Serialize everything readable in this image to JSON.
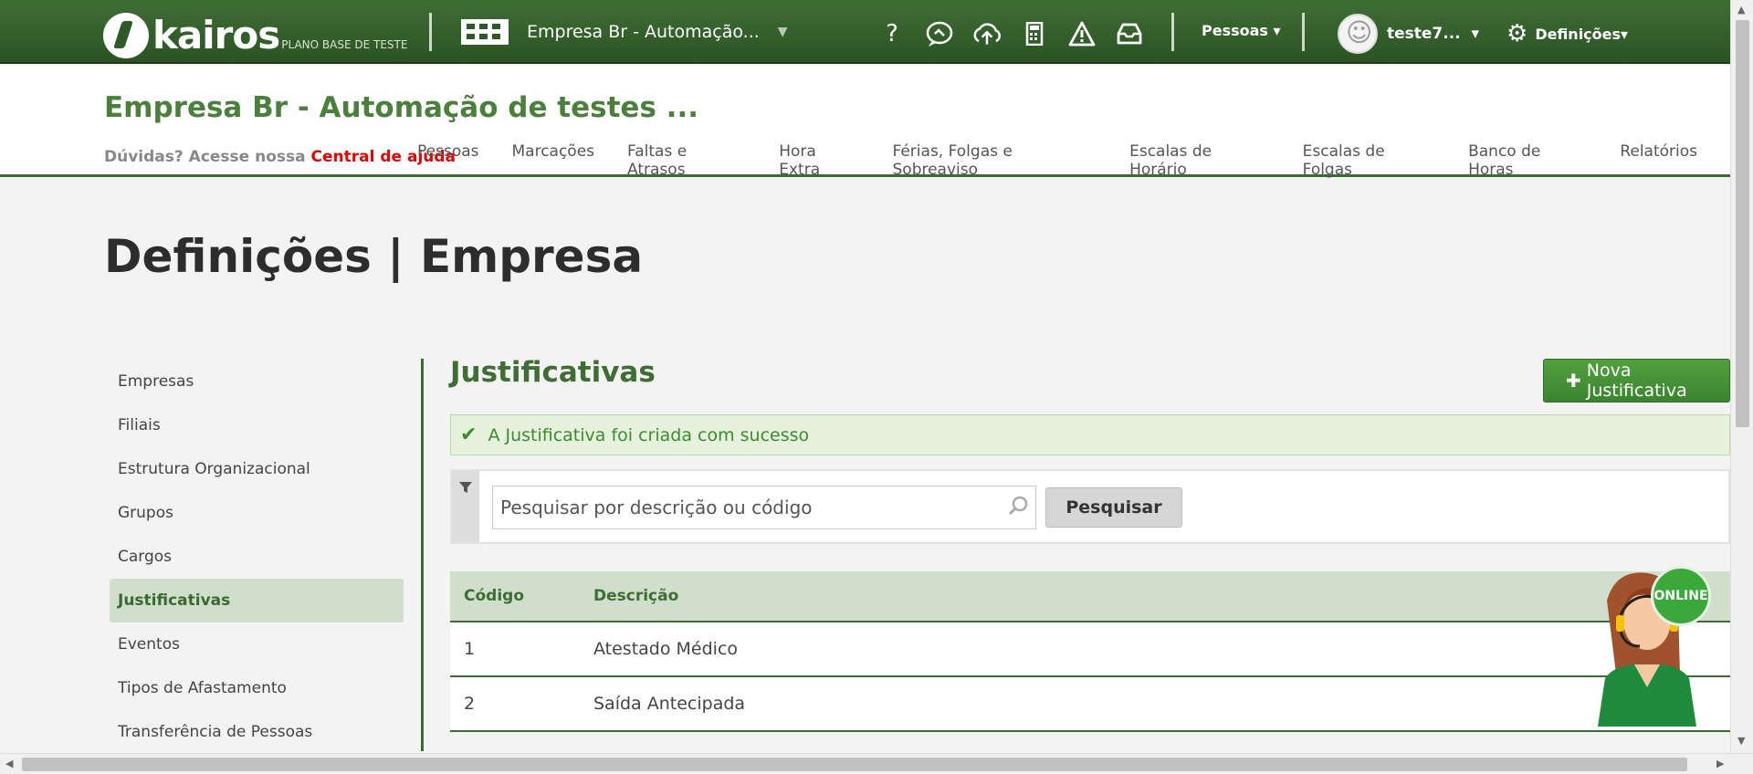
{
  "topbar": {
    "logo_text": "kairos",
    "logo_subtitle": "PLANO BASE DE TESTE",
    "company_selector": "Empresa Br - Automação...",
    "icons": [
      "help-icon",
      "support-chat-icon",
      "cloud-upload-icon",
      "calculator-icon",
      "warning-icon",
      "inbox-icon"
    ],
    "people_menu": "Pessoas",
    "user_name": "teste7...",
    "settings_menu": "Definições"
  },
  "header": {
    "company_title": "Empresa Br - Automação de testes ...",
    "help_prefix": "Dúvidas? Acesse nossa",
    "help_link": "Central de ajuda",
    "nav": [
      "Pessoas",
      "Marcações",
      "Faltas e Atrasos",
      "Hora Extra",
      "Férias, Folgas e Sobreaviso",
      "Escalas de Horário",
      "Escalas de Folgas",
      "Banco de Horas",
      "Relatórios"
    ]
  },
  "page_title": "Definições | Empresa",
  "sidebar": {
    "items": [
      "Empresas",
      "Filiais",
      "Estrutura Organizacional",
      "Grupos",
      "Cargos",
      "Justificativas",
      "Eventos",
      "Tipos de Afastamento",
      "Transferência de Pessoas"
    ],
    "active": "Justificativas"
  },
  "main": {
    "title": "Justificativas",
    "new_button": "Nova Justificativa",
    "alert": "A Justificativa foi criada com sucesso",
    "search_placeholder": "Pesquisar por descrição ou código",
    "search_button": "Pesquisar",
    "table": {
      "headers": [
        "Código",
        "Descrição"
      ],
      "rows": [
        [
          "1",
          "Atestado Médico"
        ],
        [
          "2",
          "Saída Antecipada"
        ]
      ]
    }
  },
  "chat_widget": {
    "status": "ONLINE"
  },
  "colors": {
    "primary_green": "#3f6e34",
    "link_red": "#e30000",
    "active_bg": "#cfdfcb"
  }
}
